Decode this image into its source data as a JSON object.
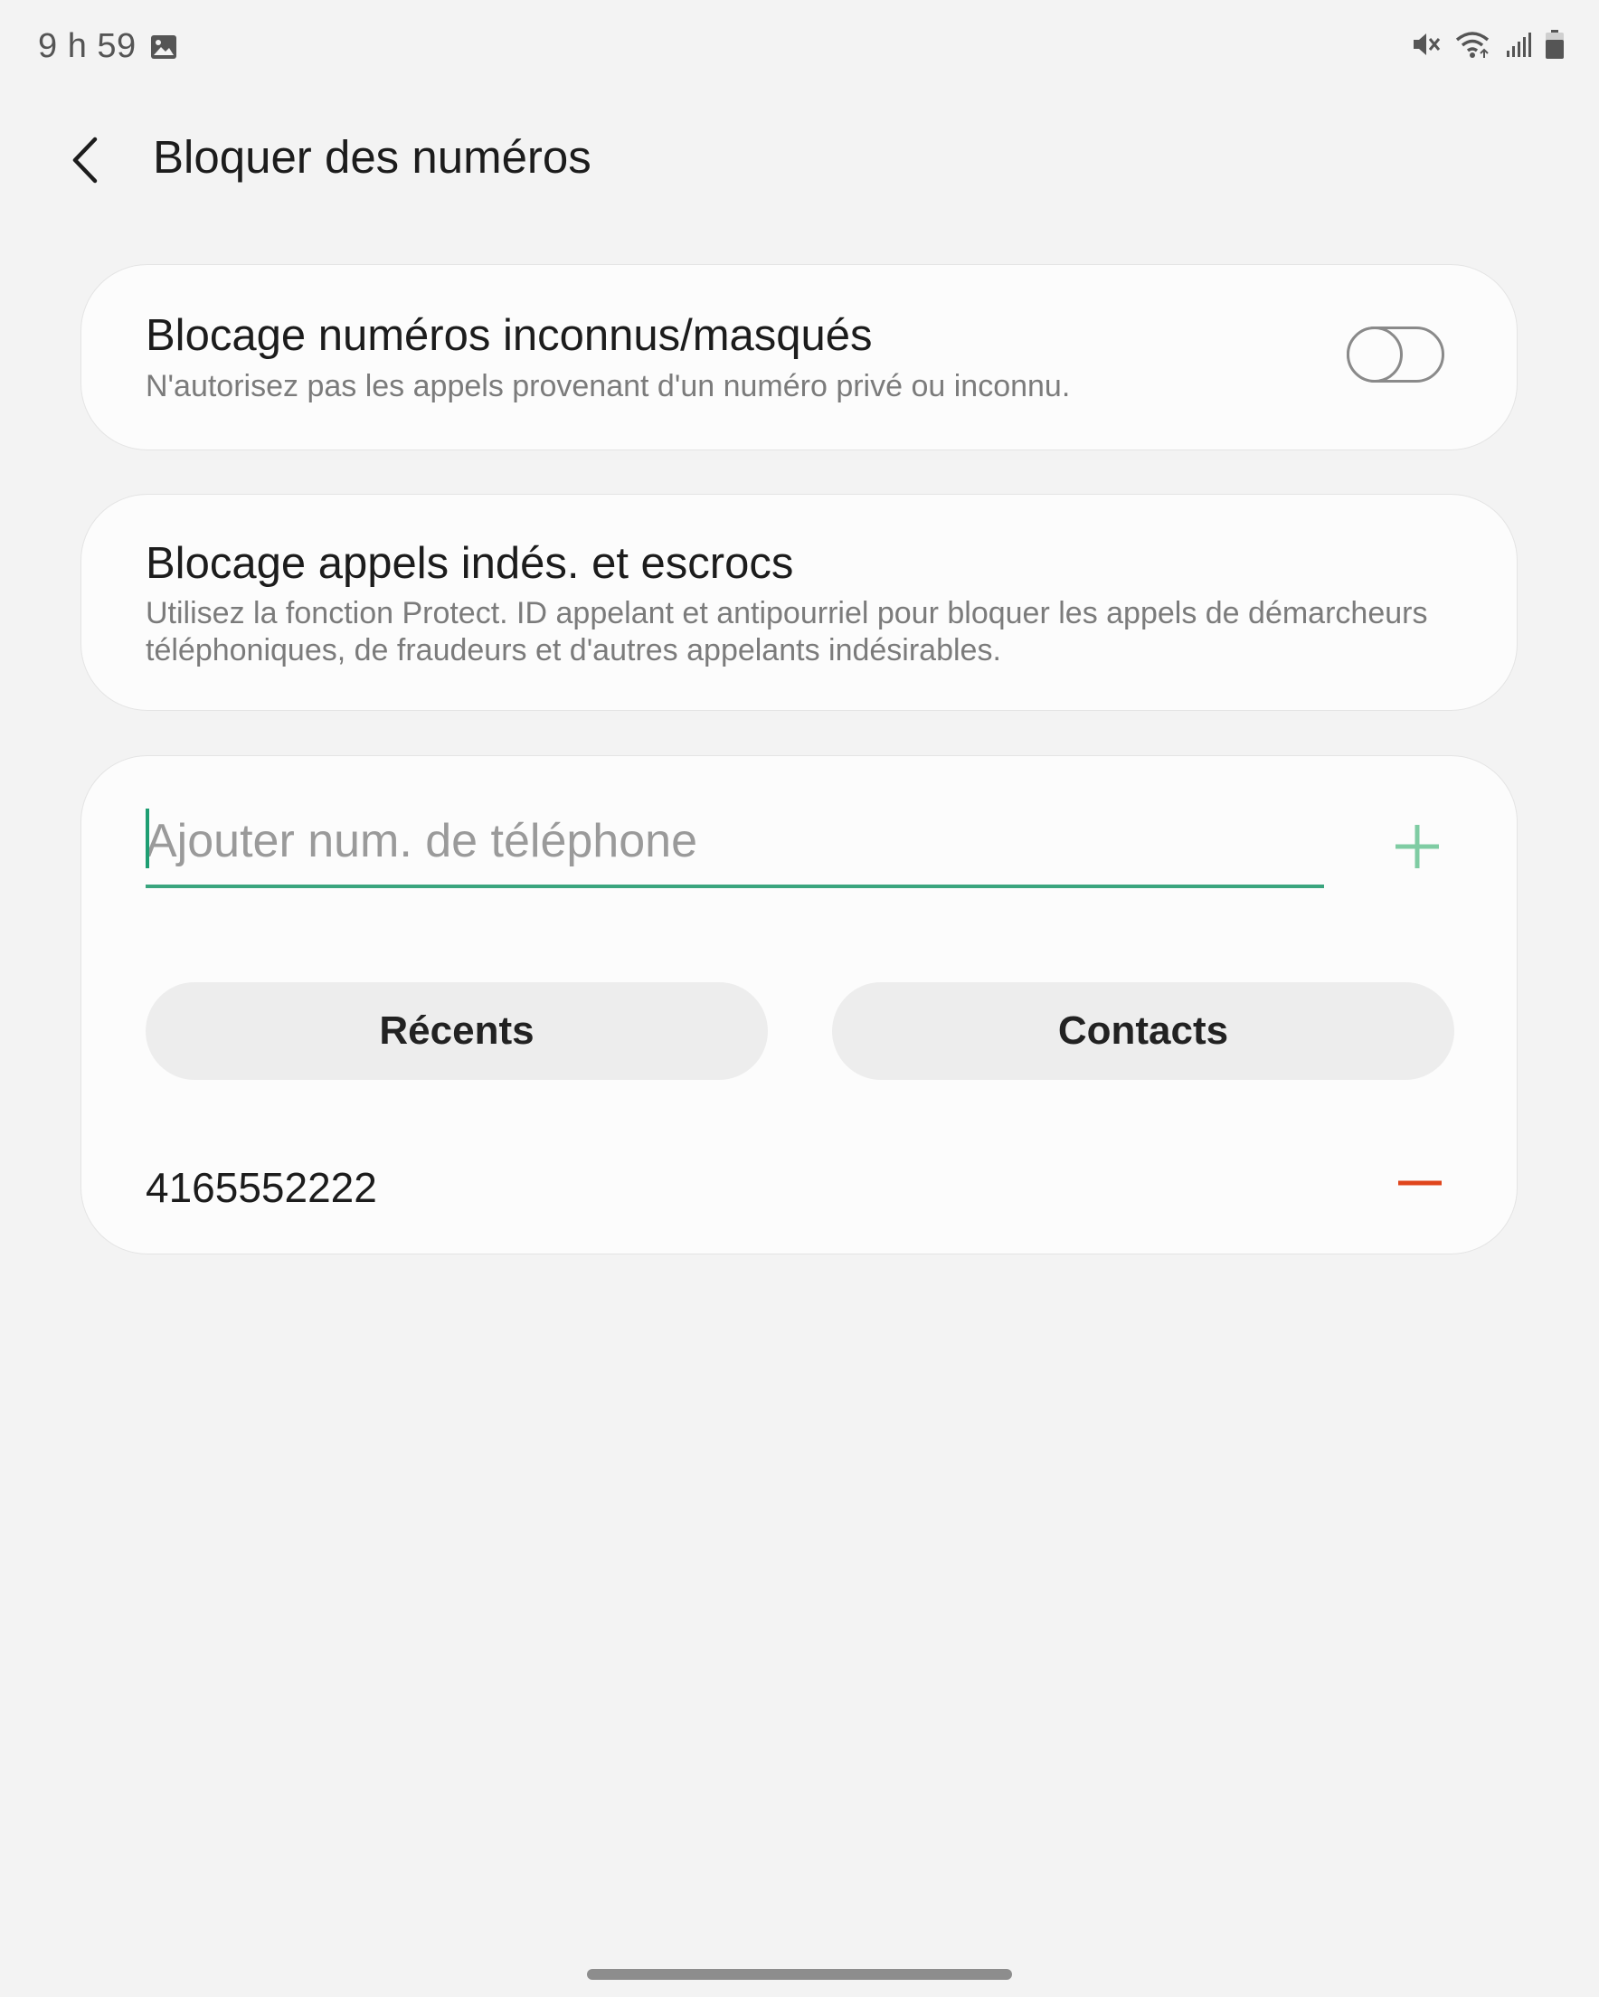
{
  "status_bar": {
    "time": "9 h 59",
    "icons": [
      "gallery-icon",
      "vibrate-mute-icon",
      "wifi-icon",
      "signal-icon",
      "battery-icon"
    ]
  },
  "header": {
    "title": "Bloquer des numéros",
    "back_icon": "chevron-left-icon"
  },
  "settings": [
    {
      "title": "Blocage numéros inconnus/masqués",
      "description": "N'autorisez pas les appels provenant d'un numéro privé ou inconnu.",
      "toggle_on": false
    },
    {
      "title": "Blocage appels indés. et escrocs",
      "description": "Utilisez la fonction Protect. ID appelant et antipourriel pour bloquer les appels de démarcheurs téléphoniques, de fraudeurs et d'autres appelants indésirables."
    }
  ],
  "block_list": {
    "input_placeholder": "Ajouter num. de téléphone",
    "input_value": "",
    "recents_label": "Récents",
    "contacts_label": "Contacts",
    "numbers": [
      "4165552222"
    ]
  },
  "colors": {
    "background": "#f3f3f3",
    "card": "#fcfcfc",
    "accent_green": "#3aa57e",
    "add_icon_green": "#7fcca3",
    "remove_red": "#e0451c"
  }
}
